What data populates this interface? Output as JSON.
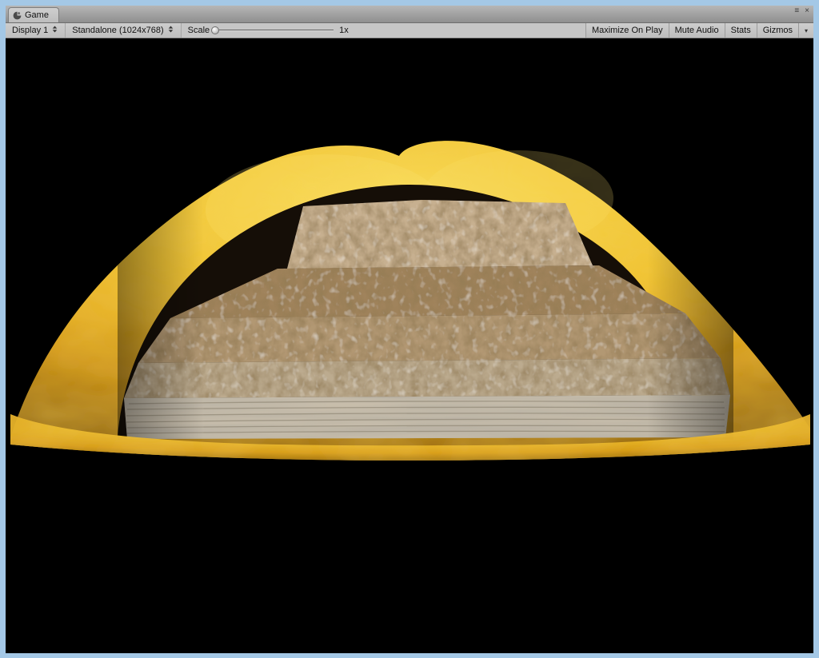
{
  "window": {
    "tab_label": "Game",
    "controls": {
      "menu_glyph": "≡",
      "close_glyph": "×"
    }
  },
  "toolbar": {
    "display_dropdown": "Display 1",
    "resolution_dropdown": "Standalone (1024x768)",
    "scale_label": "Scale",
    "scale_value": "1x",
    "slider_position": 0,
    "maximize_on_play": "Maximize On Play",
    "mute_audio": "Mute Audio",
    "stats": "Stats",
    "gizmos": "Gizmos",
    "gizmos_arrow": "▾"
  },
  "icons": {
    "game_view": "unity-game-view-icon",
    "dropdown": "up-down-triangles",
    "gizmos_dropdown": "down-triangle"
  },
  "scene": {
    "description": "Yellow draped dome shell containing a stepped pyramid of sponge-textured slabs on black background",
    "colors": {
      "background": "#000000",
      "frame": "#a4c8e6",
      "dome_highlight": "#f9dd5c",
      "dome_mid": "#f0c231",
      "dome_deep": "#d99c16",
      "dome_shadow": "#9a6a08",
      "cavity": "#150e07",
      "tier_top": "#c7b090",
      "tier_top_face": "#d4c0a1",
      "tier_upper": "#a0835c",
      "tier_mid": "#b29873",
      "tier_lower": "#bcab8f",
      "tier_base": "#c7bdab",
      "pore": "#4a3318",
      "streak": "#8d8472"
    }
  }
}
